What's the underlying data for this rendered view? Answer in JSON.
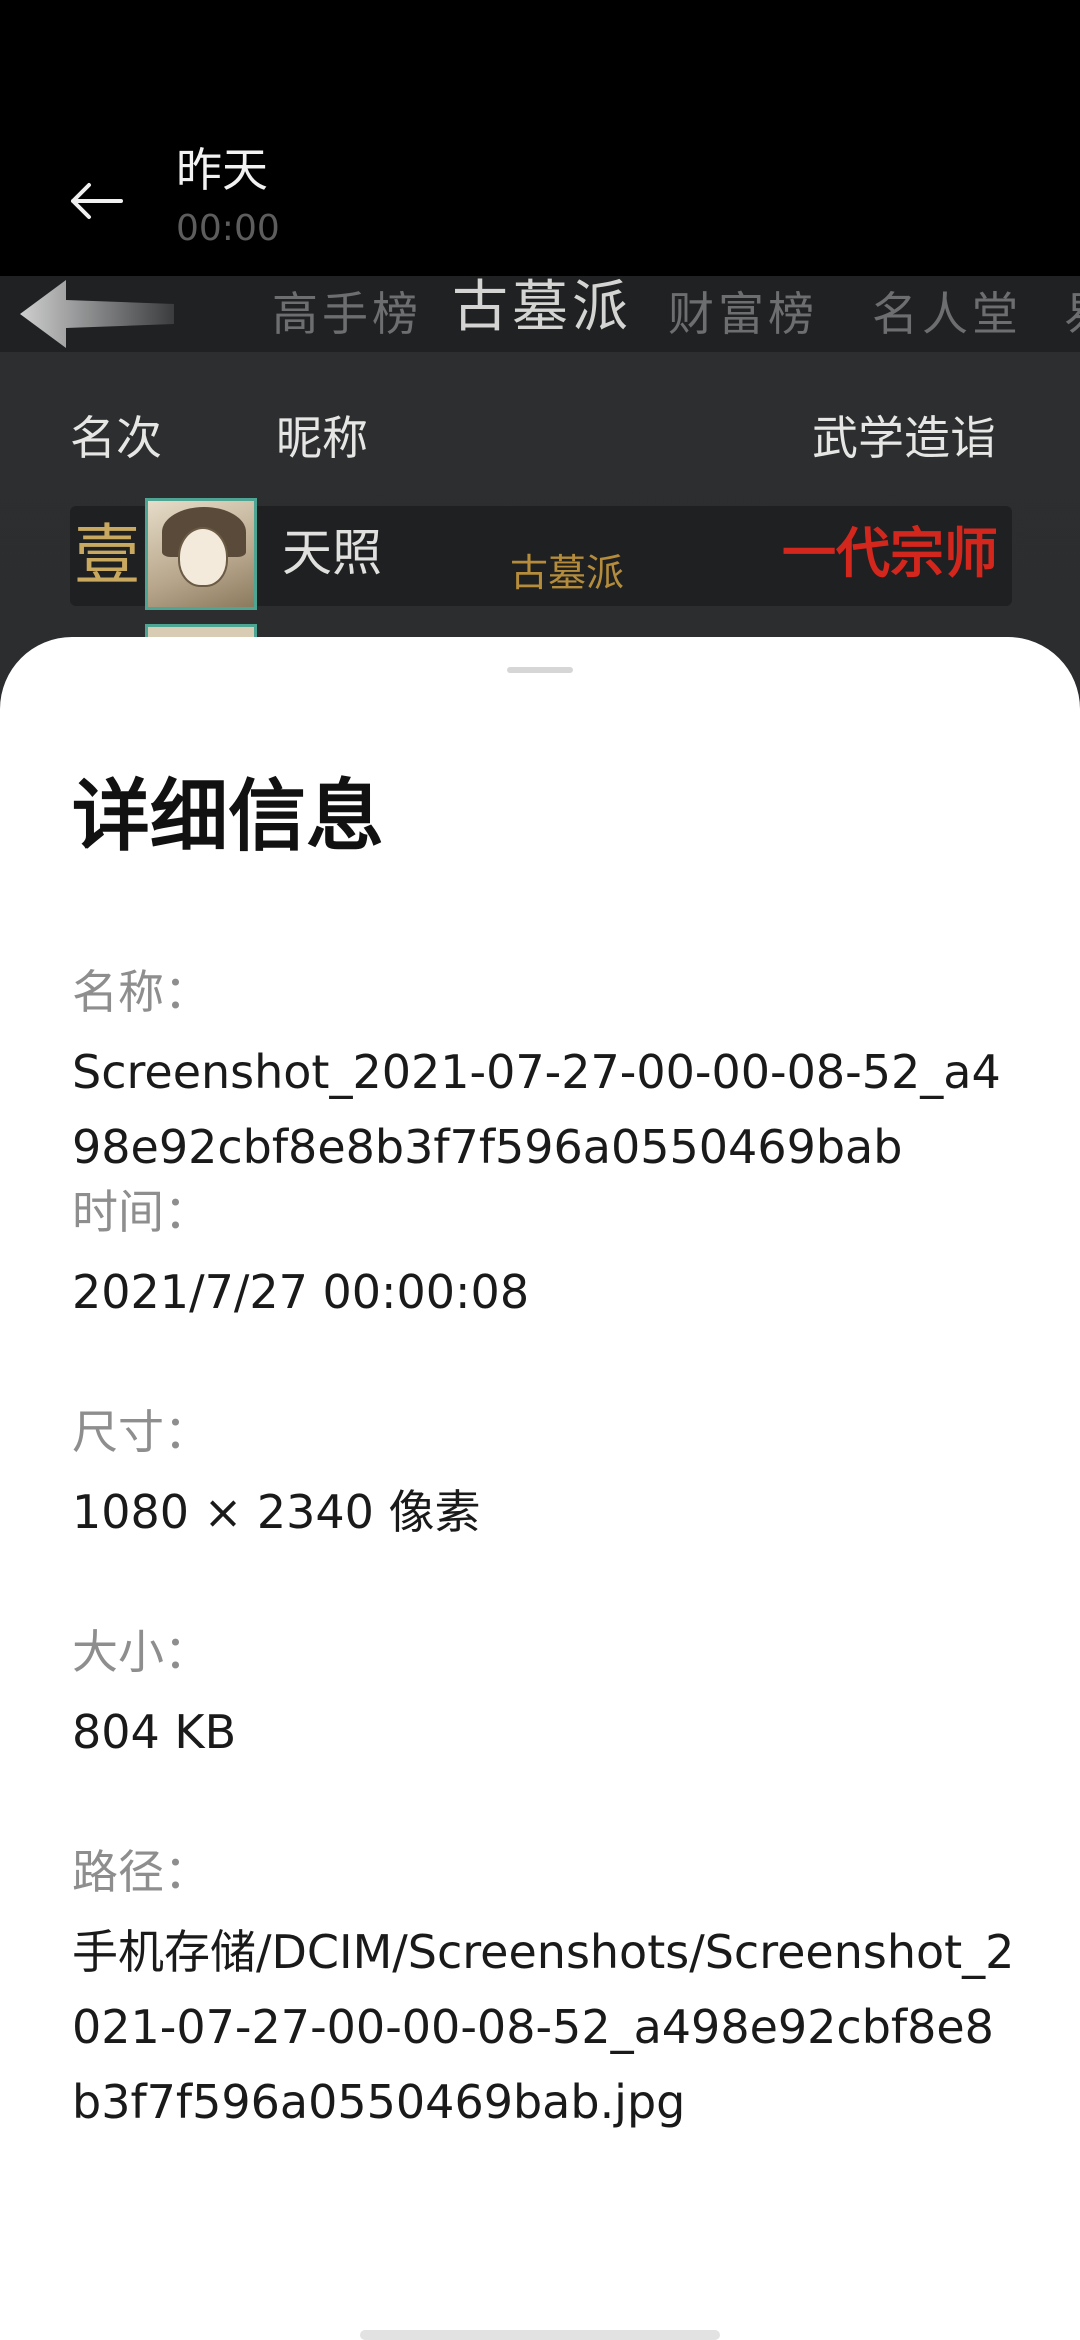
{
  "header": {
    "title": "昨天",
    "time": "00:00"
  },
  "game": {
    "tabs": [
      "高手榜",
      "古墓派",
      "财富榜",
      "名人堂",
      "易"
    ],
    "active_tab": "古墓派",
    "columns": {
      "rank": "名次",
      "nickname": "昵称",
      "skill": "武学造诣"
    },
    "first_row": {
      "rank": "壹",
      "name": "天照",
      "sect": "古墓派",
      "title": "一代宗师"
    }
  },
  "sheet": {
    "title": "详细信息",
    "fields": [
      {
        "label": "名称：",
        "value": "Screenshot_2021-07-27-00-00-08-52_a498e92cbf8e8b3f7f596a0550469bab"
      },
      {
        "label": "时间：",
        "value": "2021/7/27 00:00:08"
      },
      {
        "label": "尺寸：",
        "value": "1080 × 2340 像素"
      },
      {
        "label": "大小：",
        "value": "804 KB"
      },
      {
        "label": "路径：",
        "value": "手机存储/DCIM/Screenshots/Screenshot_2021-07-27-00-00-08-52_a498e92cbf8e8b3f7f596a0550469bab.jpg"
      }
    ]
  },
  "colors": {
    "sheet_bg": "#ffffff",
    "label": "#8e8e8e",
    "value": "#1a1a1a",
    "title_red": "#d3271e",
    "sect_gold": "#b58c3c"
  }
}
